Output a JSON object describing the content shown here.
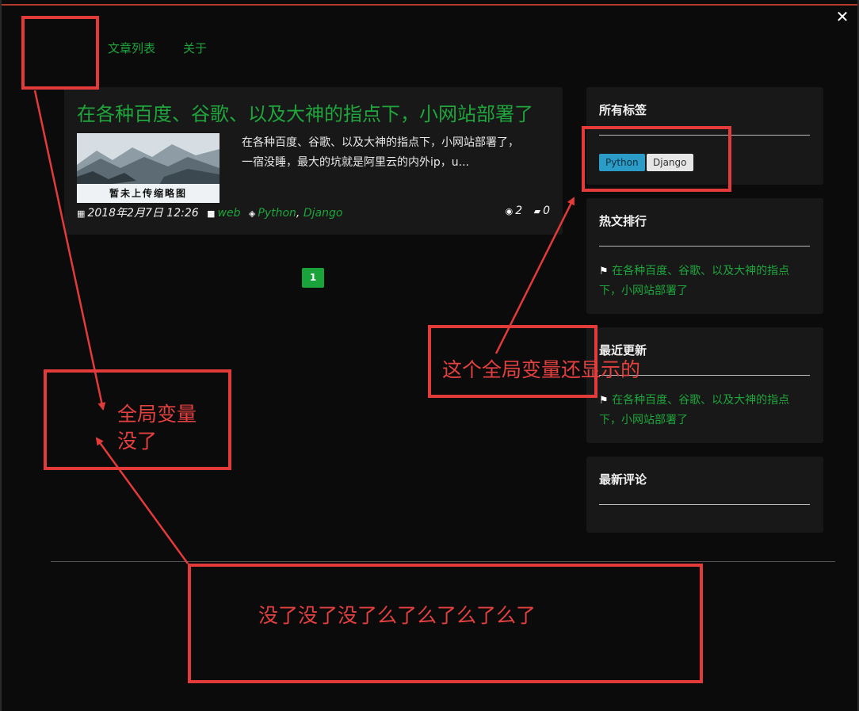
{
  "window": {
    "close_glyph": "✕"
  },
  "nav": {
    "items": [
      "文章列表",
      "关于"
    ]
  },
  "post": {
    "title": "在各种百度、谷歌、以及大神的指点下，小网站部署了",
    "thumbnail_caption": "暂未上传缩略图",
    "excerpt": "在各种百度、谷歌、以及大神的指点下，小网站部署了，一宿没睡，最大的坑就是阿里云的内外ip，u...",
    "date": "2018年2月7日 12:26",
    "category": "web",
    "tags": [
      "Python",
      "Django"
    ],
    "views": "2",
    "comments": "0"
  },
  "pagination": {
    "current": "1"
  },
  "sidebar": {
    "tags_title": "所有标签",
    "tags": [
      "Python",
      "Django"
    ],
    "hot_title": "热文排行",
    "hot_item": "在各种百度、谷歌、以及大神的指点下，小网站部署了",
    "recent_title": "最近更新",
    "recent_item": "在各种百度、谷歌、以及大神的指点下，小网站部署了",
    "comments_title": "最新评论"
  },
  "annotations": {
    "global_var_shown": "这个全局变量还显示的",
    "global_var_gone_line1": "全局变量",
    "global_var_gone_line2": "没了",
    "footer_gone": "没了没了没了么了么了么了么了"
  },
  "colors": {
    "accent_green": "#1fa53c",
    "annotation_red": "#e33a3a",
    "tag_blue": "#2b9bc8"
  }
}
